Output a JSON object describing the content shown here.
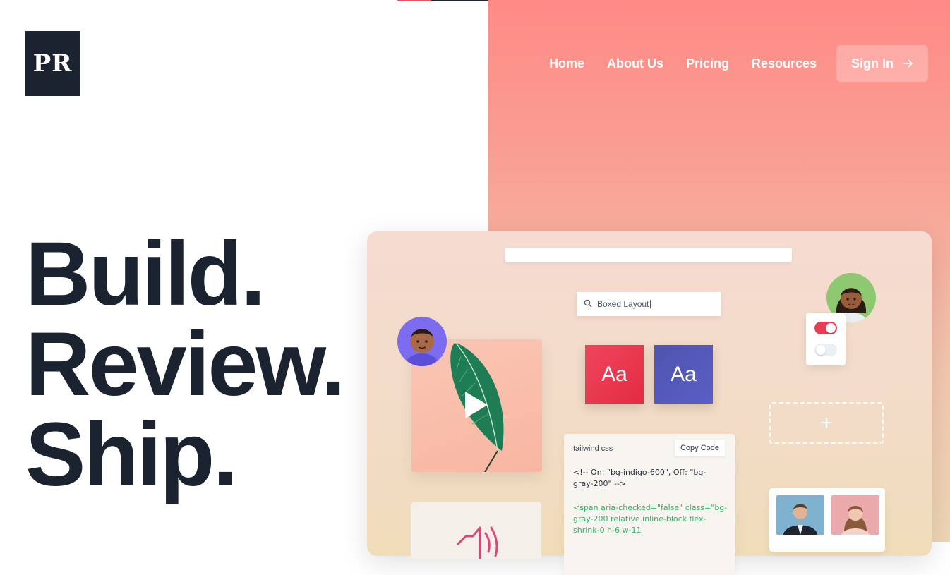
{
  "logo": {
    "text": "PR"
  },
  "nav": {
    "links": [
      {
        "label": "Home"
      },
      {
        "label": "About Us"
      },
      {
        "label": "Pricing"
      },
      {
        "label": "Resources"
      }
    ],
    "signin_label": "Sign In",
    "signin_icon": "arrow-right-icon"
  },
  "hero": {
    "lines": [
      "Build.",
      "Review.",
      "Ship."
    ]
  },
  "mockup": {
    "search": {
      "value": "Boxed Layout",
      "icon": "search-icon"
    },
    "typography_samples": [
      "Aa",
      "Aa"
    ],
    "toggles": [
      {
        "state": "on"
      },
      {
        "state": "off"
      }
    ],
    "add_placeholder_symbol": "+",
    "code_card": {
      "title": "tailwind css",
      "copy_label": "Copy Code",
      "comment": "<!-- On: \"bg-indigo-600\", Off: \"bg-gray-200\" -->",
      "snippet": "<span aria-checked=\"false\" class=\"bg-gray-200 relative inline-block flex-shrink-0 h-6 w-11"
    }
  },
  "colors": {
    "dark": "#1b2230",
    "coral": "#ff8a86",
    "accent_red": "#ee3b55",
    "indigo": "#4e55ad",
    "code_green": "#2fb36a"
  }
}
